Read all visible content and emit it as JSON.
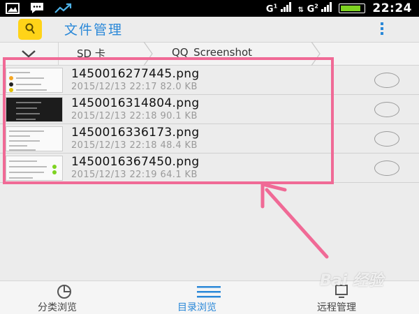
{
  "status_bar": {
    "time": "22:24",
    "signal1_label": "G",
    "signal1_index": "1",
    "signal2_label": "G",
    "signal2_index": "2",
    "icons": [
      "gallery-icon",
      "chat-icon",
      "trend-icon"
    ]
  },
  "header": {
    "title": "文件管理",
    "icon": "app-folder-icon",
    "menu_icon": "overflow-menu-icon"
  },
  "breadcrumb": {
    "items": [
      "SD 卡",
      "QQ_Screenshot"
    ]
  },
  "files": [
    {
      "name": "1450016277445.png",
      "meta": "2015/12/13 22:17  82.0 KB",
      "thumb": "light"
    },
    {
      "name": "1450016314804.png",
      "meta": "2015/12/13 22:18  90.1 KB",
      "thumb": "dark"
    },
    {
      "name": "1450016336173.png",
      "meta": "2015/12/13 22:18  48.4 KB",
      "thumb": "light"
    },
    {
      "name": "1450016367450.png",
      "meta": "2015/12/13 22:19  64.1 KB",
      "thumb": "light"
    }
  ],
  "bottom_nav": {
    "items": [
      {
        "label": "分类浏览",
        "icon": "pie-chart-icon",
        "active": false
      },
      {
        "label": "目录浏览",
        "icon": "list-icon",
        "active": true
      },
      {
        "label": "远程管理",
        "icon": "remote-icon",
        "active": false
      }
    ]
  },
  "colors": {
    "accent": "#2a88d8",
    "highlight": "#f06a96",
    "app_icon": "#ffd318"
  }
}
